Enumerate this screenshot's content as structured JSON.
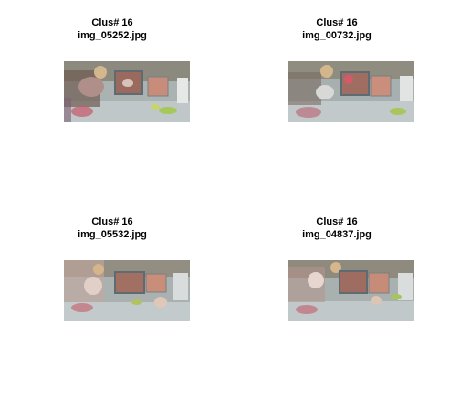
{
  "panels": [
    {
      "cluster_label": "Clus# 16",
      "filename": "img_05252.jpg",
      "variant": "a"
    },
    {
      "cluster_label": "Clus# 16",
      "filename": "img_00732.jpg",
      "variant": "b"
    },
    {
      "cluster_label": "Clus# 16",
      "filename": "img_05532.jpg",
      "variant": "c"
    },
    {
      "cluster_label": "Clus# 16",
      "filename": "img_04837.jpg",
      "variant": "d"
    }
  ]
}
